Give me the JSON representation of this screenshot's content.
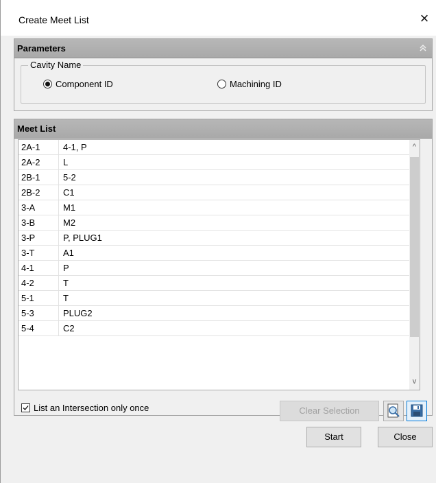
{
  "window": {
    "title": "Create Meet List",
    "close_glyph": "×"
  },
  "parameters": {
    "header": "Parameters",
    "cavity_group_label": "Cavity Name",
    "options": [
      {
        "label": "Component ID",
        "selected": true
      },
      {
        "label": "Machining ID",
        "selected": false
      }
    ]
  },
  "meet_list": {
    "header": "Meet List",
    "rows": [
      {
        "id": "2A-1",
        "meets": "4-1, P"
      },
      {
        "id": "2A-2",
        "meets": "L"
      },
      {
        "id": "2B-1",
        "meets": "5-2"
      },
      {
        "id": "2B-2",
        "meets": "C1"
      },
      {
        "id": "3-A",
        "meets": "M1"
      },
      {
        "id": "3-B",
        "meets": "M2"
      },
      {
        "id": "3-P",
        "meets": "P, PLUG1"
      },
      {
        "id": "3-T",
        "meets": "A1"
      },
      {
        "id": "4-1",
        "meets": "P"
      },
      {
        "id": "4-2",
        "meets": "T"
      },
      {
        "id": "5-1",
        "meets": "T"
      },
      {
        "id": "5-3",
        "meets": "PLUG2"
      },
      {
        "id": "5-4",
        "meets": "C2"
      }
    ],
    "scroll_up_glyph": "^",
    "scroll_down_glyph": "v",
    "intersection_checkbox": {
      "label": "List an Intersection only once",
      "checked": true
    },
    "clear_selection_label": "Clear Selection"
  },
  "icons": {
    "preview": "magnifier-document-icon",
    "save": "floppy-save-icon",
    "collapse": "double-chevron-up-icon"
  },
  "buttons": {
    "start": "Start",
    "close": "Close"
  },
  "colors": {
    "header_gray": "#adadad",
    "focus_blue": "#0078d7"
  }
}
